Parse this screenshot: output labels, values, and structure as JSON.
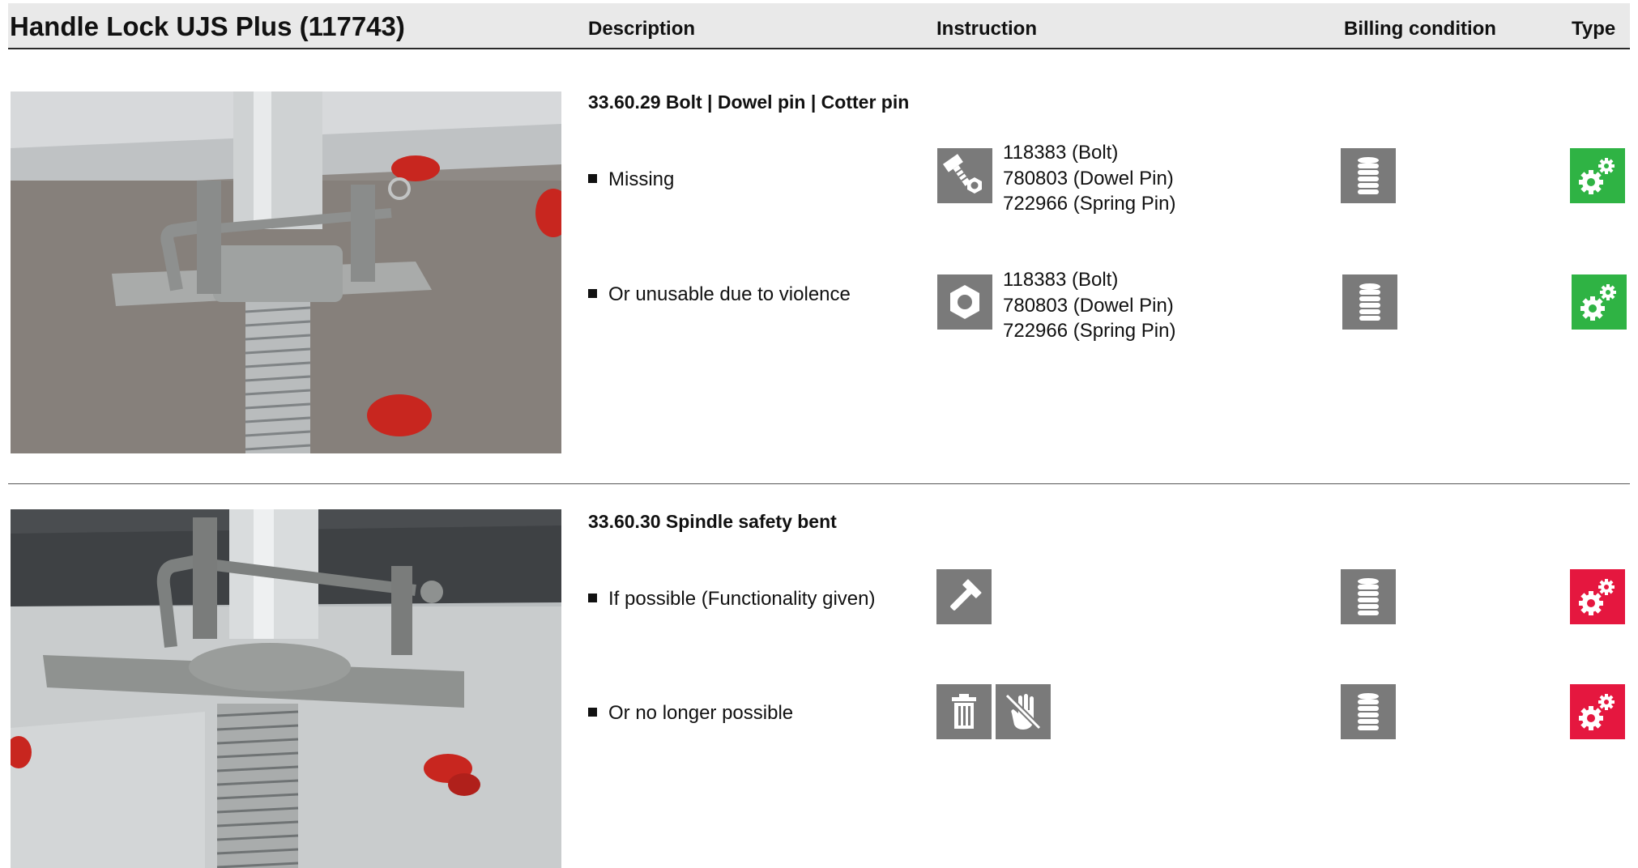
{
  "header": {
    "title": "Handle Lock UJS Plus (117743)",
    "col_description": "Description",
    "col_instruction": "Instruction",
    "col_billing": "Billing condition",
    "col_type": "Type"
  },
  "sections": [
    {
      "title": "33.60.29 Bolt | Dowel pin | Cotter pin",
      "photo": "photo-spindle-handle-lock",
      "items": [
        {
          "label": "Missing",
          "instruction_icons": [
            "bolt-nut-icon"
          ],
          "parts": [
            "118383 (Bolt)",
            "780803 (Dowel Pin)",
            "722966 (Spring Pin)"
          ],
          "billing_icon": "coin-stack-icon",
          "type_icon": "gears-icon",
          "type_color": "#2fb344"
        },
        {
          "label": "Or unusable due to violence",
          "instruction_icons": [
            "nut-icon"
          ],
          "parts": [
            "118383 (Bolt)",
            "780803 (Dowel Pin)",
            "722966 (Spring Pin)"
          ],
          "billing_icon": "coin-stack-icon",
          "type_icon": "gears-icon",
          "type_color": "#2fb344"
        }
      ]
    },
    {
      "title": "33.60.30 Spindle safety bent",
      "photo": "photo-spindle-safety-bent",
      "items": [
        {
          "label": "If possible (Functionality given)",
          "instruction_icons": [
            "hammer-icon"
          ],
          "parts": [],
          "billing_icon": "coin-stack-icon",
          "type_icon": "gears-icon",
          "type_color": "#e5173f"
        },
        {
          "label": "Or no longer possible",
          "instruction_icons": [
            "trash-icon",
            "no-hand-icon"
          ],
          "parts": [],
          "billing_icon": "coin-stack-icon",
          "type_icon": "gears-icon",
          "type_color": "#e5173f"
        }
      ]
    }
  ]
}
